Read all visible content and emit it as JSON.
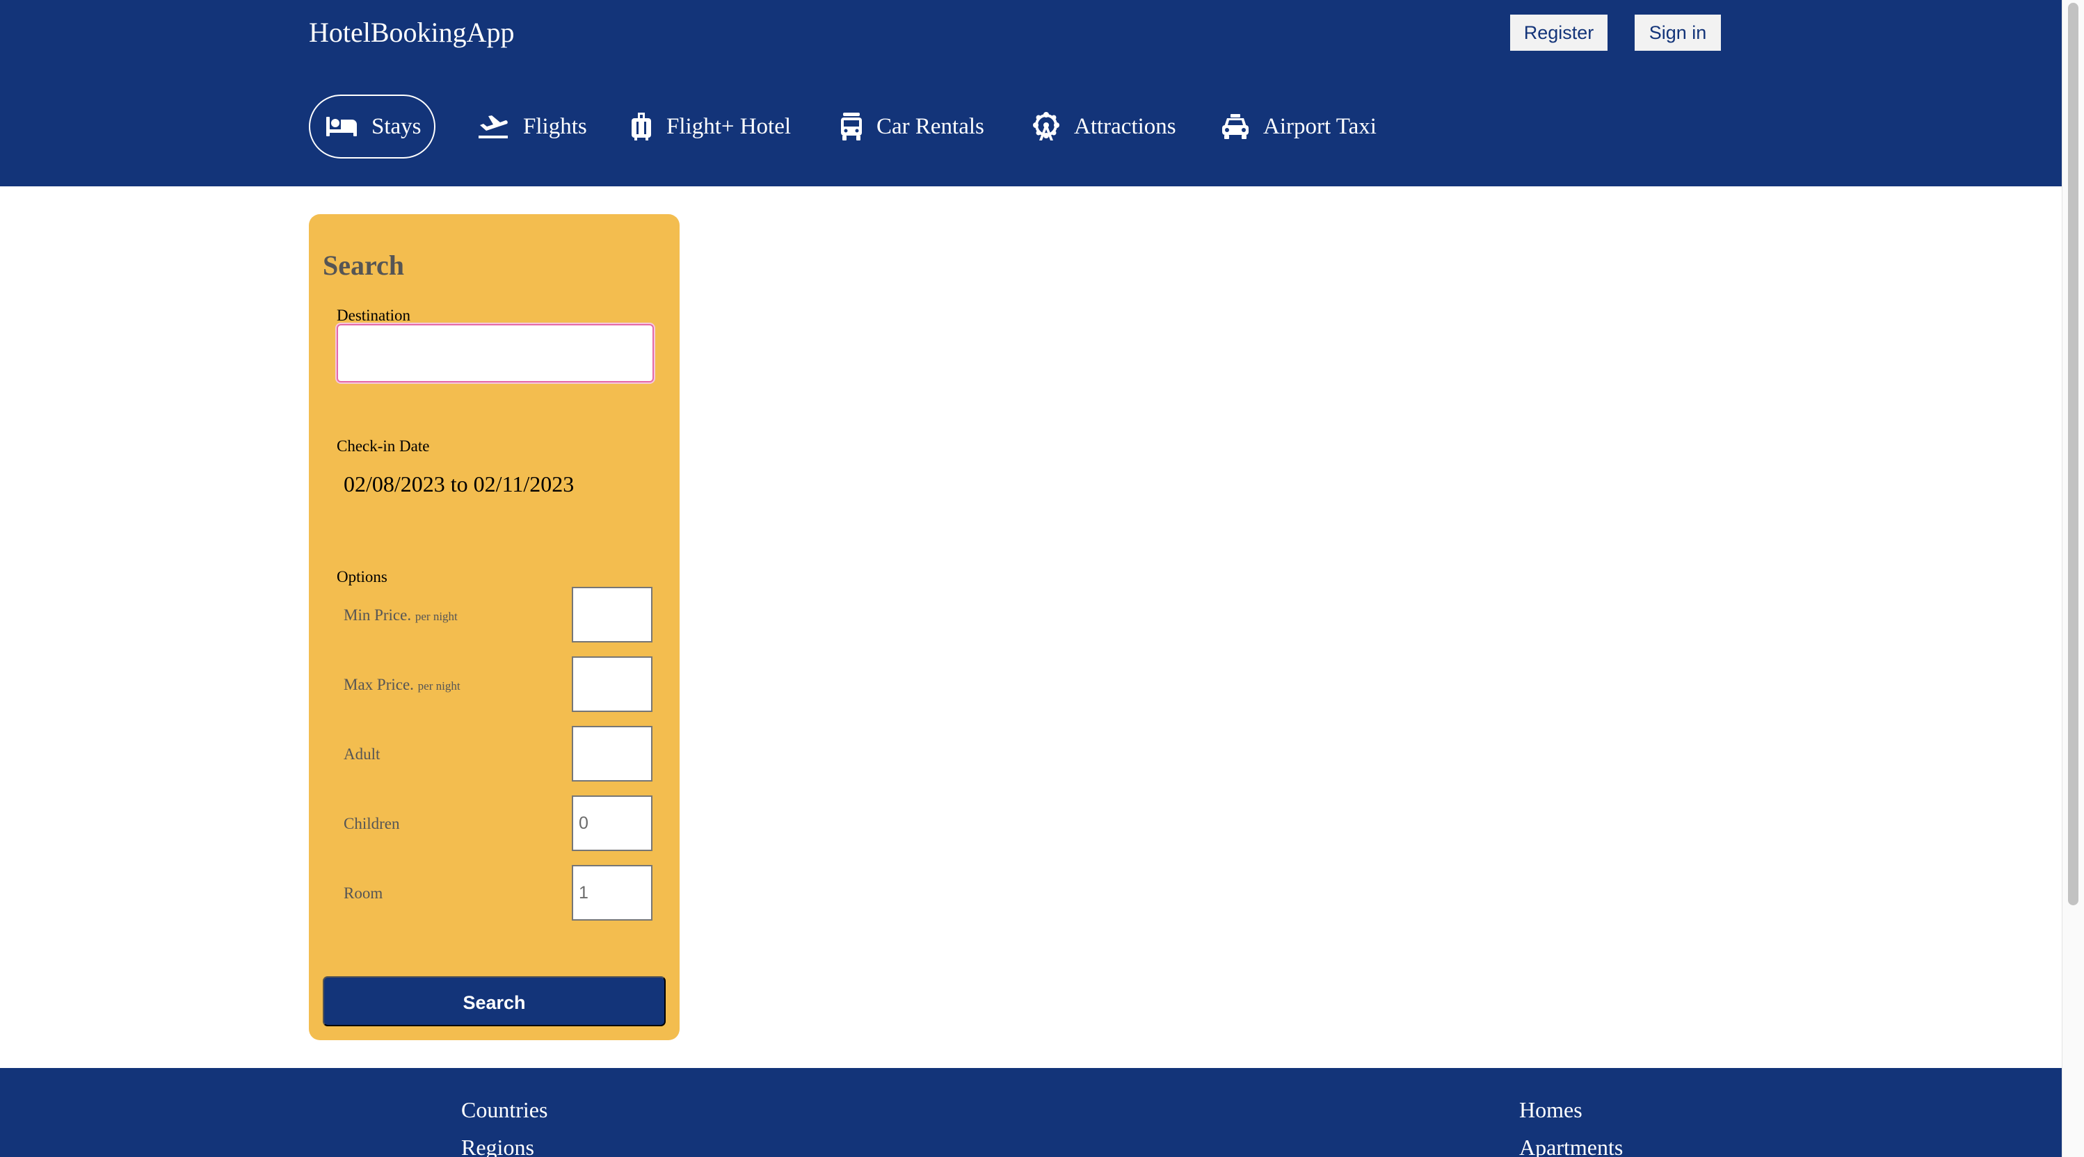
{
  "app": {
    "title": "HotelBookingApp"
  },
  "header": {
    "register_label": "Register",
    "signin_label": "Sign in"
  },
  "nav": {
    "items": [
      {
        "label": "Stays",
        "icon": "bed-icon",
        "active": true
      },
      {
        "label": "Flights",
        "icon": "plane-icon",
        "active": false
      },
      {
        "label": "Flight+ Hotel",
        "icon": "luggage-icon",
        "active": false
      },
      {
        "label": "Car Rentals",
        "icon": "car-rental-icon",
        "active": false
      },
      {
        "label": "Attractions",
        "icon": "ferris-wheel-icon",
        "active": false
      },
      {
        "label": "Airport Taxi",
        "icon": "taxi-icon",
        "active": false
      }
    ]
  },
  "search": {
    "title": "Search",
    "destination_label": "Destination",
    "destination_value": "",
    "checkin_label": "Check-in Date",
    "date_range": "02/08/2023 to 02/11/2023",
    "options_label": "Options",
    "options": [
      {
        "label": "Min Price",
        "suffix": "per night",
        "value": ""
      },
      {
        "label": "Max Price",
        "suffix": "per night",
        "value": ""
      },
      {
        "label": "Adult",
        "suffix": "",
        "value": ""
      },
      {
        "label": "Children",
        "suffix": "",
        "value": "0"
      },
      {
        "label": "Room",
        "suffix": "",
        "value": "1"
      }
    ],
    "button_label": "Search"
  },
  "footer": {
    "left_links": [
      "Countries",
      "Regions"
    ],
    "right_links": [
      "Homes",
      "Apartments"
    ]
  },
  "colors": {
    "brand": "#133479",
    "panel": "#f3bd4f",
    "focus": "#e46aa8"
  }
}
